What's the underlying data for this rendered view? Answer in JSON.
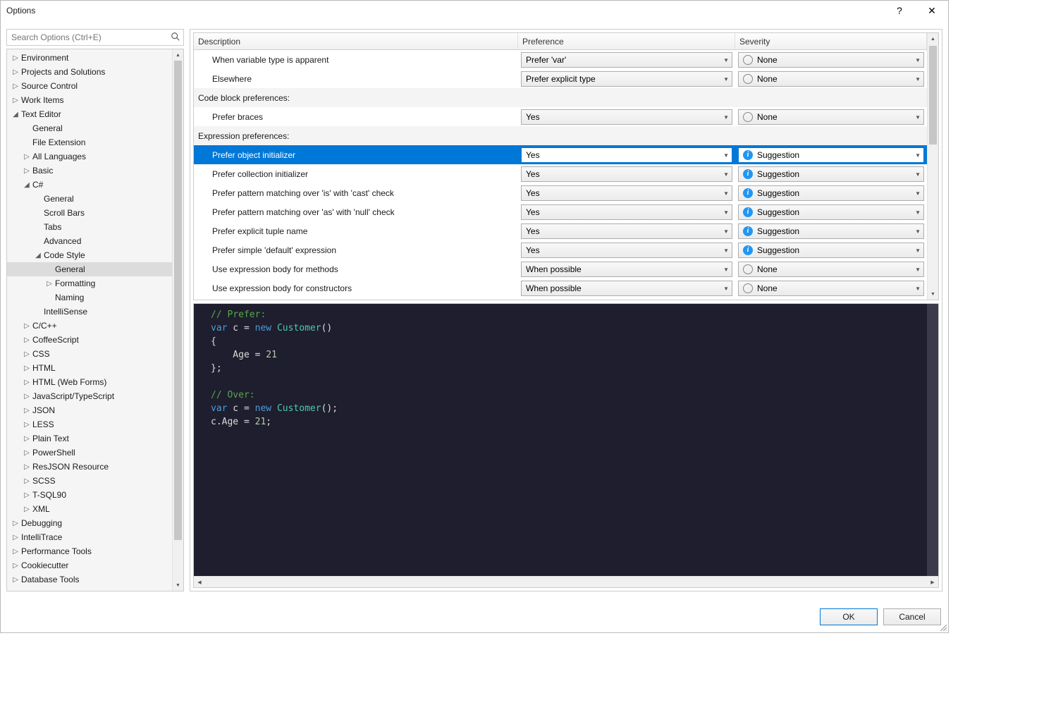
{
  "window": {
    "title": "Options",
    "help": "?",
    "close": "✕"
  },
  "search": {
    "placeholder": "Search Options (Ctrl+E)"
  },
  "tree": [
    {
      "depth": 0,
      "arw": "▷",
      "label": "Environment"
    },
    {
      "depth": 0,
      "arw": "▷",
      "label": "Projects and Solutions"
    },
    {
      "depth": 0,
      "arw": "▷",
      "label": "Source Control"
    },
    {
      "depth": 0,
      "arw": "▷",
      "label": "Work Items"
    },
    {
      "depth": 0,
      "arw": "◢",
      "label": "Text Editor"
    },
    {
      "depth": 1,
      "arw": "",
      "label": "General"
    },
    {
      "depth": 1,
      "arw": "",
      "label": "File Extension"
    },
    {
      "depth": 1,
      "arw": "▷",
      "label": "All Languages"
    },
    {
      "depth": 1,
      "arw": "▷",
      "label": "Basic"
    },
    {
      "depth": 1,
      "arw": "◢",
      "label": "C#"
    },
    {
      "depth": 2,
      "arw": "",
      "label": "General"
    },
    {
      "depth": 2,
      "arw": "",
      "label": "Scroll Bars"
    },
    {
      "depth": 2,
      "arw": "",
      "label": "Tabs"
    },
    {
      "depth": 2,
      "arw": "",
      "label": "Advanced"
    },
    {
      "depth": 2,
      "arw": "◢",
      "label": "Code Style"
    },
    {
      "depth": 3,
      "arw": "",
      "label": "General",
      "selected": true
    },
    {
      "depth": 3,
      "arw": "▷",
      "label": "Formatting"
    },
    {
      "depth": 3,
      "arw": "",
      "label": "Naming"
    },
    {
      "depth": 2,
      "arw": "",
      "label": "IntelliSense"
    },
    {
      "depth": 1,
      "arw": "▷",
      "label": "C/C++"
    },
    {
      "depth": 1,
      "arw": "▷",
      "label": "CoffeeScript"
    },
    {
      "depth": 1,
      "arw": "▷",
      "label": "CSS"
    },
    {
      "depth": 1,
      "arw": "▷",
      "label": "HTML"
    },
    {
      "depth": 1,
      "arw": "▷",
      "label": "HTML (Web Forms)"
    },
    {
      "depth": 1,
      "arw": "▷",
      "label": "JavaScript/TypeScript"
    },
    {
      "depth": 1,
      "arw": "▷",
      "label": "JSON"
    },
    {
      "depth": 1,
      "arw": "▷",
      "label": "LESS"
    },
    {
      "depth": 1,
      "arw": "▷",
      "label": "Plain Text"
    },
    {
      "depth": 1,
      "arw": "▷",
      "label": "PowerShell"
    },
    {
      "depth": 1,
      "arw": "▷",
      "label": "ResJSON Resource"
    },
    {
      "depth": 1,
      "arw": "▷",
      "label": "SCSS"
    },
    {
      "depth": 1,
      "arw": "▷",
      "label": "T-SQL90"
    },
    {
      "depth": 1,
      "arw": "▷",
      "label": "XML"
    },
    {
      "depth": 0,
      "arw": "▷",
      "label": "Debugging"
    },
    {
      "depth": 0,
      "arw": "▷",
      "label": "IntelliTrace"
    },
    {
      "depth": 0,
      "arw": "▷",
      "label": "Performance Tools"
    },
    {
      "depth": 0,
      "arw": "▷",
      "label": "Cookiecutter"
    },
    {
      "depth": 0,
      "arw": "▷",
      "label": "Database Tools"
    }
  ],
  "table": {
    "headers": {
      "desc": "Description",
      "pref": "Preference",
      "sev": "Severity"
    },
    "rows": [
      {
        "type": "item",
        "desc": "When variable type is apparent",
        "pref": "Prefer 'var'",
        "sev": "None",
        "sevIcon": "none"
      },
      {
        "type": "item",
        "desc": "Elsewhere",
        "pref": "Prefer explicit type",
        "sev": "None",
        "sevIcon": "none"
      },
      {
        "type": "group",
        "desc": "Code block preferences:"
      },
      {
        "type": "item",
        "desc": "Prefer braces",
        "pref": "Yes",
        "sev": "None",
        "sevIcon": "none"
      },
      {
        "type": "group",
        "desc": "Expression preferences:"
      },
      {
        "type": "item",
        "desc": "Prefer object initializer",
        "pref": "Yes",
        "sev": "Suggestion",
        "sevIcon": "sugg",
        "selected": true
      },
      {
        "type": "item",
        "desc": "Prefer collection initializer",
        "pref": "Yes",
        "sev": "Suggestion",
        "sevIcon": "sugg"
      },
      {
        "type": "item",
        "desc": "Prefer pattern matching over 'is' with 'cast' check",
        "pref": "Yes",
        "sev": "Suggestion",
        "sevIcon": "sugg"
      },
      {
        "type": "item",
        "desc": "Prefer pattern matching over 'as' with 'null' check",
        "pref": "Yes",
        "sev": "Suggestion",
        "sevIcon": "sugg"
      },
      {
        "type": "item",
        "desc": "Prefer explicit tuple name",
        "pref": "Yes",
        "sev": "Suggestion",
        "sevIcon": "sugg"
      },
      {
        "type": "item",
        "desc": "Prefer simple 'default' expression",
        "pref": "Yes",
        "sev": "Suggestion",
        "sevIcon": "sugg"
      },
      {
        "type": "item",
        "desc": "Use expression body for methods",
        "pref": "When possible",
        "sev": "None",
        "sevIcon": "none"
      },
      {
        "type": "item",
        "desc": "Use expression body for constructors",
        "pref": "When possible",
        "sev": "None",
        "sevIcon": "none"
      }
    ]
  },
  "code": {
    "lines": [
      [
        {
          "c": "c-cmt",
          "t": "// Prefer:"
        }
      ],
      [
        {
          "c": "c-kw",
          "t": "var"
        },
        {
          "c": "c-txt",
          "t": " c = "
        },
        {
          "c": "c-kw",
          "t": "new"
        },
        {
          "c": "c-txt",
          "t": " "
        },
        {
          "c": "c-cls",
          "t": "Customer"
        },
        {
          "c": "c-txt",
          "t": "()"
        }
      ],
      [
        {
          "c": "c-txt",
          "t": "{"
        }
      ],
      [
        {
          "c": "c-txt",
          "t": "    Age = "
        },
        {
          "c": "c-num",
          "t": "21"
        }
      ],
      [
        {
          "c": "c-txt",
          "t": "};"
        }
      ],
      [
        {
          "c": "c-txt",
          "t": ""
        }
      ],
      [
        {
          "c": "c-cmt",
          "t": "// Over:"
        }
      ],
      [
        {
          "c": "c-kw",
          "t": "var"
        },
        {
          "c": "c-txt",
          "t": " c = "
        },
        {
          "c": "c-kw",
          "t": "new"
        },
        {
          "c": "c-txt",
          "t": " "
        },
        {
          "c": "c-cls",
          "t": "Customer"
        },
        {
          "c": "c-txt",
          "t": "();"
        }
      ],
      [
        {
          "c": "c-txt",
          "t": "c.Age = "
        },
        {
          "c": "c-num",
          "t": "21"
        },
        {
          "c": "c-txt",
          "t": ";"
        }
      ]
    ]
  },
  "footer": {
    "ok": "OK",
    "cancel": "Cancel"
  }
}
